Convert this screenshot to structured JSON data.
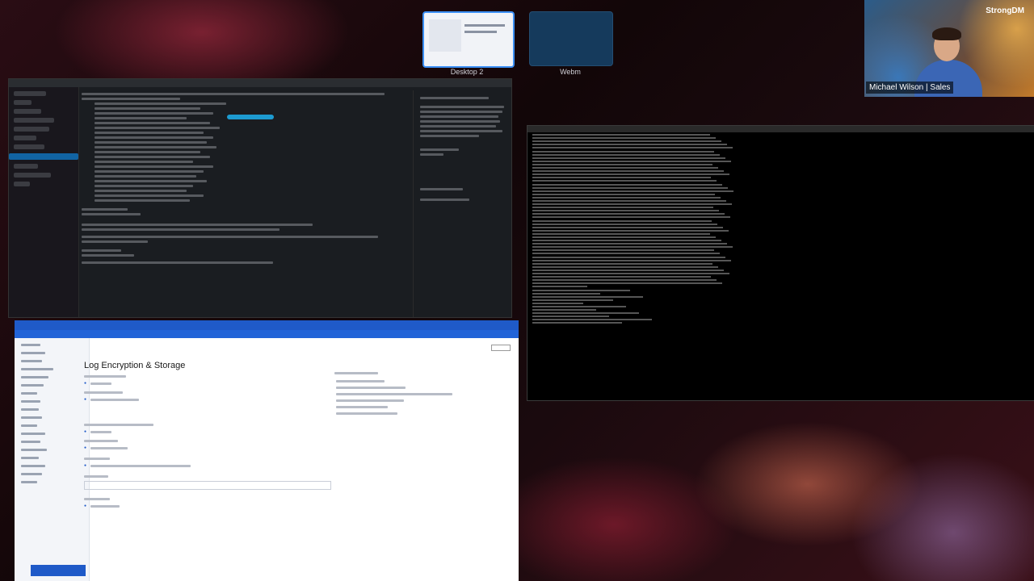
{
  "desktops": [
    {
      "label": "Desktop 2",
      "selected": true
    },
    {
      "label": "Webm",
      "selected": false
    }
  ],
  "camera": {
    "brand": "StrongDM",
    "name_caption": "Michael Wilson | Sales"
  },
  "browser": {
    "page_title": "Log Encryption & Storage"
  },
  "colors": {
    "accent_blue": "#1f5ac8",
    "slack_select": "#1164a3",
    "terminal_bg": "#000000"
  }
}
